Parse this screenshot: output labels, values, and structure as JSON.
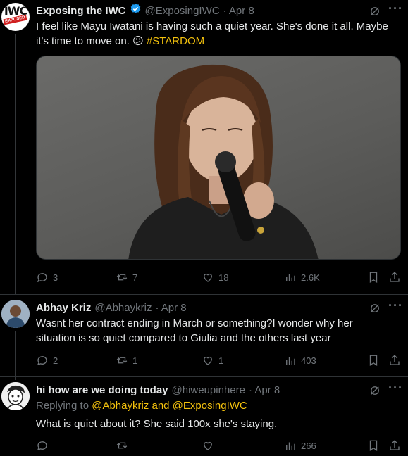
{
  "tweets": [
    {
      "name": "Exposing the IWC",
      "handle": "@ExposingIWC",
      "date": "· Apr 8",
      "avatar_text": "IWC",
      "avatar_sub": "EXPOSED",
      "text_part1": "I feel like Mayu Iwatani is having such a quiet year.  She's done it all. Maybe it's time to move on.",
      "emoji": "😕",
      "hashtag": "#STARDOM",
      "replies": "3",
      "reposts": "7",
      "likes": "18",
      "views": "2.6K"
    },
    {
      "name": "Abhay Kriz",
      "handle": "@Abhaykriz",
      "date": "· Apr 8",
      "text": "Wasnt her contract ending in March or something?I wonder why her situation is so quiet compared to Giulia and the others last year",
      "replies": "2",
      "reposts": "1",
      "likes": "1",
      "views": "403"
    },
    {
      "name": "hi how are we doing today",
      "handle": "@hiweupinhere",
      "date": "· Apr 8",
      "replying_prefix": "Replying to",
      "replying_to": "@Abhaykriz and @ExposingIWC",
      "text": "What is quiet about it? She said 100x she's staying.",
      "views": "266"
    }
  ],
  "colors": {
    "accent": "#f4c20d",
    "verified": "#1d9bf0",
    "muted": "#71767b"
  }
}
